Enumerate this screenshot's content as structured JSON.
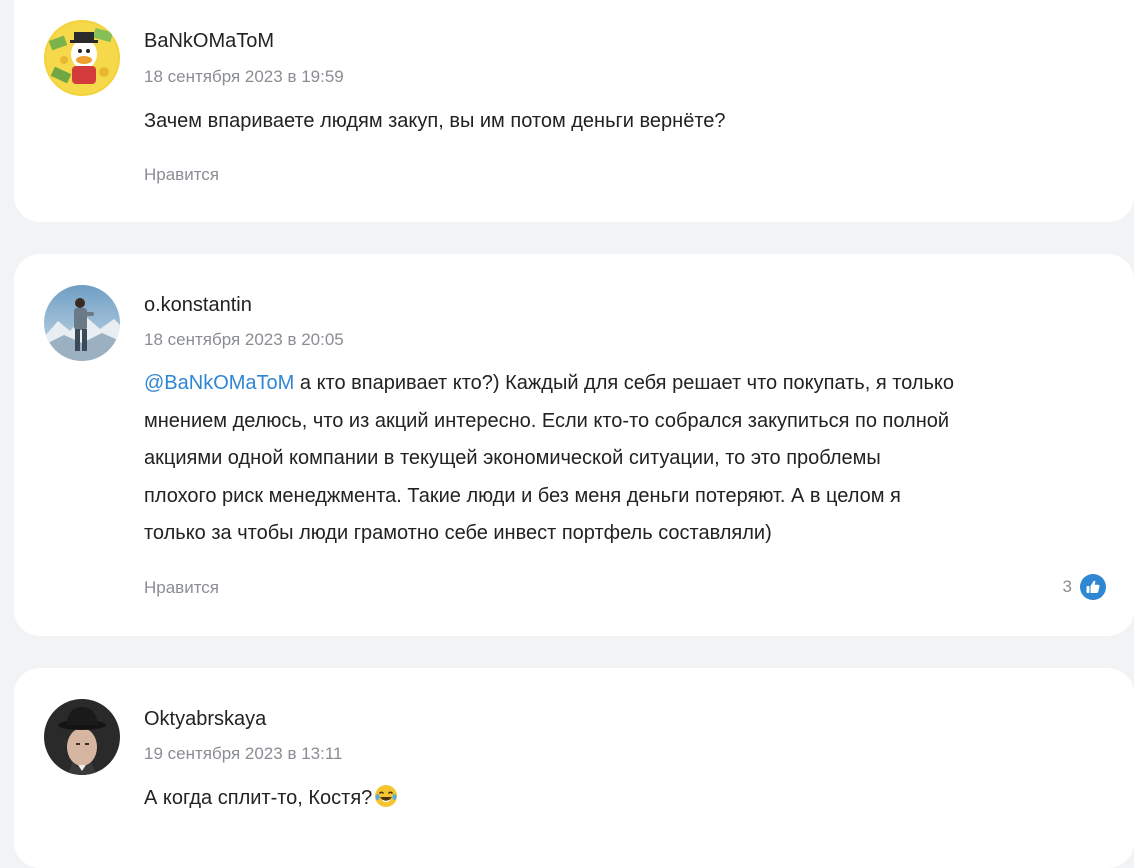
{
  "comments": [
    {
      "author": "BaNkOMaToM",
      "date": "18 сентября 2023 в 19:59",
      "text": "Зачем впариваете людям закуп, вы им потом деньги вернёте?",
      "like_label": "Нравится",
      "avatar_icon": "cartoon-duck-money-avatar-icon"
    },
    {
      "author": "o.konstantin",
      "date": "18 сентября 2023 в 20:05",
      "mention": "@BaNkOMaToM",
      "text_lines": [
        " а кто впаривает кто?) Каждый для себя решает что покупать, я только",
        "мнением делюсь, что из акций интересно. Если кто-то собрался закупиться по полной",
        "акциями одной компании в текущей экономической ситуации, то это проблемы",
        "плохого риск менеджмента. Такие люди и без меня деньги потеряют. А в целом я",
        "только за чтобы люди грамотно себе инвест портфель составляли)"
      ],
      "like_label": "Нравится",
      "reaction_count": "3",
      "reaction_icon": "thumbs-up-icon",
      "avatar_icon": "man-on-mountain-avatar-icon"
    },
    {
      "author": "Oktyabrskaya",
      "date": "19 сентября 2023 в 13:11",
      "text": "А когда сплит-то, Костя?",
      "emoji_icon": "laughing-tears-emoji-icon",
      "avatar_icon": "man-in-bowler-hat-avatar-icon"
    }
  ],
  "colors": {
    "page_background": "#f2f3f5",
    "card_background": "#ffffff",
    "mention": "#2f86d2",
    "meta_text": "#8a8d93",
    "reaction": "#2f86d2"
  }
}
